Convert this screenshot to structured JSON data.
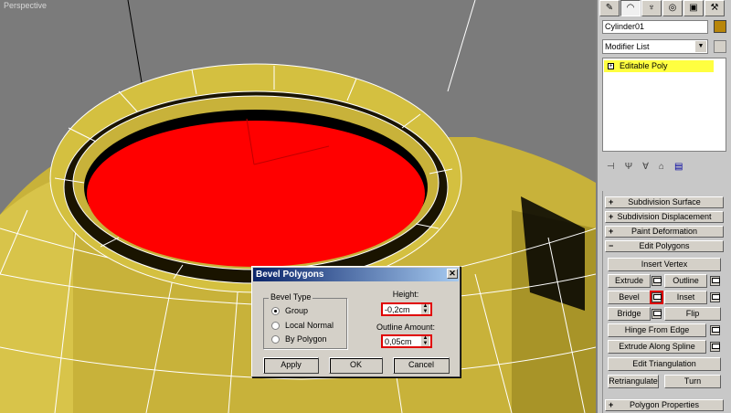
{
  "viewport": {
    "label": "Perspective"
  },
  "dialog": {
    "title": "Bevel Polygons",
    "bevel_type": {
      "legend": "Bevel Type",
      "options": [
        "Group",
        "Local Normal",
        "By Polygon"
      ],
      "selected": "Group"
    },
    "height": {
      "label": "Height:",
      "value": "-0,2cm"
    },
    "outline_amount": {
      "label": "Outline Amount:",
      "value": "0,05cm"
    },
    "buttons": {
      "apply": "Apply",
      "ok": "OK",
      "cancel": "Cancel"
    }
  },
  "panel": {
    "tabs": [
      "create-icon",
      "modify-icon",
      "hierarchy-icon",
      "motion-icon",
      "display-icon",
      "utilities-icon"
    ],
    "object_name": "Cylinder01",
    "object_color": "#b8860b",
    "modifier_list": "Modifier List",
    "stack": [
      {
        "label": "Editable Poly",
        "selected": true
      }
    ],
    "rollouts": {
      "subdivision_surface": "Subdivision Surface",
      "subdivision_displacement": "Subdivision Displacement",
      "paint_deformation": "Paint Deformation",
      "edit_polygons": "Edit Polygons",
      "polygon_properties": "Polygon Properties"
    },
    "edit_polygons": {
      "insert_vertex": "Insert Vertex",
      "extrude": "Extrude",
      "outline": "Outline",
      "bevel": "Bevel",
      "inset": "Inset",
      "bridge": "Bridge",
      "flip": "Flip",
      "hinge_from_edge": "Hinge From Edge",
      "extrude_along_spline": "Extrude Along Spline",
      "edit_triangulation": "Edit Triangulation",
      "retriangulate": "Retriangulate",
      "turn": "Turn"
    }
  }
}
